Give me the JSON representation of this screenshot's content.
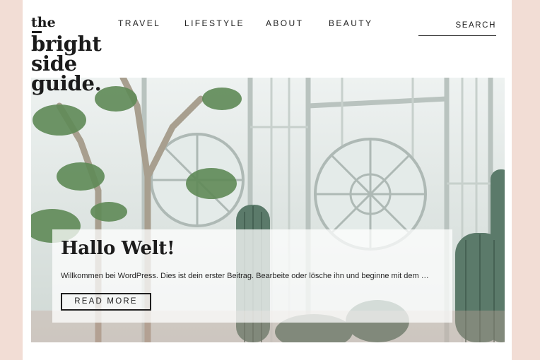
{
  "logo": {
    "line1": "the",
    "line2": "bright",
    "line3": "side",
    "line4": "guide."
  },
  "nav": {
    "items": [
      "TRAVEL",
      "LIFESTYLE",
      "ABOUT",
      "BEAUTY"
    ]
  },
  "search": {
    "label": "SEARCH"
  },
  "post": {
    "title": "Hallo Welt!",
    "excerpt": "Willkommen bei WordPress. Dies ist dein erster Beitrag. Bearbeite oder lösche ihn und beginne mit dem …",
    "button": "READ MORE"
  },
  "colors": {
    "page_background": "#f2ddd5",
    "content_background": "#ffffff",
    "text": "#1b1b1b"
  },
  "hero": {
    "icon": "greenhouse-photo"
  }
}
